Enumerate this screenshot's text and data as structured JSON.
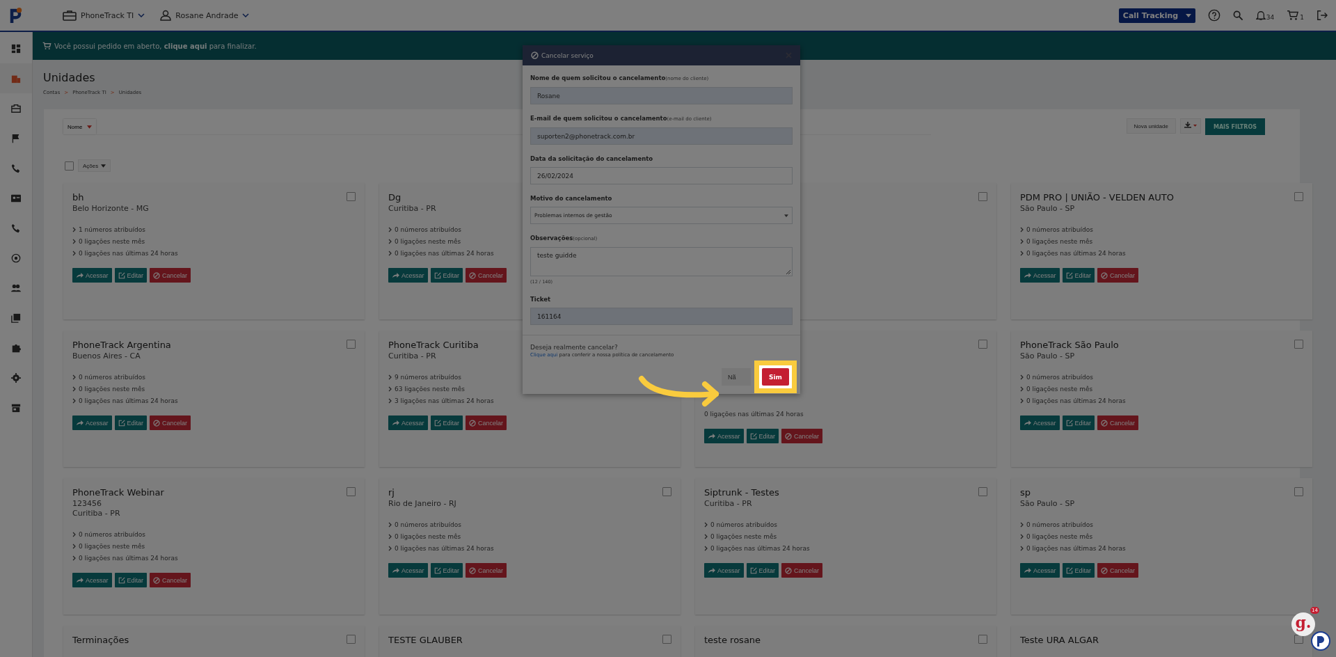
{
  "topbar": {
    "company": "PhoneTrack TI",
    "user": "Rosane Andrade",
    "product": "Call Tracking",
    "notifications": "34",
    "cart": "1"
  },
  "sidebar": {
    "items": [
      {
        "selected": false
      },
      {
        "selected": true
      },
      {
        "selected": false
      },
      {
        "selected": false
      },
      {
        "selected": false
      },
      {
        "selected": false
      },
      {
        "selected": false
      },
      {
        "selected": false
      },
      {
        "selected": false
      },
      {
        "selected": false
      },
      {
        "selected": false
      },
      {
        "selected": false
      },
      {
        "selected": false
      }
    ]
  },
  "banner": {
    "before": "Você possui pedido em aberto, ",
    "link": "clique aqui",
    "after": " para finalizar."
  },
  "page": {
    "title": "Unidades",
    "breadcrumb": [
      {
        "kind": "link",
        "text": "Contas"
      },
      {
        "kind": "separator",
        "text": ">"
      },
      {
        "kind": "link",
        "text": "PhoneTrack TI"
      },
      {
        "kind": "separator",
        "text": ">"
      },
      {
        "kind": "link",
        "text": "Unidades"
      }
    ]
  },
  "filters": {
    "sort": "Nome",
    "new_button": "Nova unidade",
    "more_button": "MAIS FILTROS"
  },
  "bulk": {
    "checked": false,
    "actions": "Ações"
  },
  "cards": [
    {
      "title": "bh",
      "lines": [
        "Belo Horizonte - MG"
      ],
      "checked": false,
      "stats": [
        "1 números atribuídos",
        "0 ligações neste mês",
        "0 ligações nas últimas 24 horas"
      ],
      "buttons": [
        {
          "kind": "access",
          "label": "Acessar"
        },
        {
          "kind": "edit",
          "label": "Editar"
        },
        {
          "kind": "cancel",
          "label": "Cancelar"
        }
      ]
    },
    {
      "title": "Dg",
      "lines": [
        "Curitiba - PR"
      ],
      "stats": [
        "0 números atribuídos",
        "0 ligações neste mês",
        "0 ligações nas últimas 24 horas"
      ],
      "buttons": [
        {
          "kind": "access",
          "label": "Acessar"
        },
        {
          "kind": "edit",
          "label": "Editar"
        },
        {
          "kind": "cancel",
          "label": "Cancelar"
        }
      ]
    },
    {
      "checked": false
    },
    {
      "title": "PDM PRO | UNIÃO - VELDEN AUTO",
      "lines": [
        "São Paulo - SP"
      ],
      "checked": false,
      "stats": [
        "0 números atribuídos",
        "0 ligações neste mês",
        "0 ligações nas últimas 24 horas"
      ],
      "buttons": [
        {
          "kind": "access",
          "label": "Acessar"
        },
        {
          "kind": "edit",
          "label": "Editar"
        },
        {
          "kind": "cancel",
          "label": "Cancelar"
        }
      ]
    },
    {
      "title": "PhoneTrack Argentina",
      "lines": [
        "Buenos Aires - CA"
      ],
      "checked": false,
      "stats": [
        "0 números atribuídos",
        "0 ligações neste mês",
        "0 ligações nas últimas 24 horas"
      ],
      "buttons": [
        {
          "kind": "access",
          "label": "Acessar"
        },
        {
          "kind": "edit",
          "label": "Editar"
        },
        {
          "kind": "cancel",
          "label": "Cancelar"
        }
      ]
    },
    {
      "title": "PhoneTrack Curitiba",
      "lines": [
        "Curitiba - PR"
      ],
      "stats": [
        "9 números atribuídos",
        "63 ligações neste mês",
        "3 ligações nas últimas 24 horas"
      ],
      "buttons": [
        {
          "kind": "access",
          "label": "Acessar"
        },
        {
          "kind": "edit",
          "label": "Editar"
        },
        {
          "kind": "cancel",
          "label": "Cancelar"
        }
      ]
    },
    {
      "checked": false,
      "stats_below": [
        "0 ligações nas últimas 24 horas"
      ],
      "buttons": [
        {
          "kind": "access",
          "label": "Acessar"
        },
        {
          "kind": "edit",
          "label": "Editar"
        },
        {
          "kind": "cancel",
          "label": "Cancelar"
        }
      ]
    },
    {
      "title": "PhoneTrack São Paulo",
      "lines": [
        "São Paulo - SP"
      ],
      "checked": false,
      "stats": [
        "0 números atribuídos",
        "0 ligações neste mês",
        "0 ligações nas últimas 24 horas"
      ],
      "buttons": [
        {
          "kind": "access",
          "label": "Acessar"
        },
        {
          "kind": "edit",
          "label": "Editar"
        },
        {
          "kind": "cancel",
          "label": "Cancelar"
        }
      ]
    },
    {
      "title": "PhoneTrack Webinar",
      "lines": [
        "123456",
        "Curitiba - PR"
      ],
      "checked": false,
      "stats": [
        "0 números atribuídos",
        "0 ligações neste mês",
        "0 ligações nas últimas 24 horas"
      ],
      "buttons": [
        {
          "kind": "access",
          "label": "Acessar"
        },
        {
          "kind": "edit",
          "label": "Editar"
        },
        {
          "kind": "cancel",
          "label": "Cancelar"
        }
      ]
    },
    {
      "title": "rj",
      "lines": [
        "Rio de Janeiro - RJ"
      ],
      "checked": false,
      "stats": [
        "0 números atribuídos",
        "0 ligações neste mês",
        "0 ligações nas últimas 24 horas"
      ],
      "buttons": [
        {
          "kind": "access",
          "label": "Acessar"
        },
        {
          "kind": "edit",
          "label": "Editar"
        },
        {
          "kind": "cancel",
          "label": "Cancelar"
        }
      ]
    },
    {
      "title": "Siptrunk - Testes",
      "lines": [
        "Curitiba - PR"
      ],
      "checked": false,
      "stats": [
        "0 números atribuídos",
        "0 ligações neste mês",
        "0 ligações nas últimas 24 horas"
      ],
      "buttons": [
        {
          "kind": "access",
          "label": "Acessar"
        },
        {
          "kind": "edit",
          "label": "Editar"
        },
        {
          "kind": "cancel",
          "label": "Cancelar"
        }
      ]
    },
    {
      "title": "sp",
      "lines": [
        "São Paulo - SP"
      ],
      "checked": false,
      "stats": [
        "0 números atribuídos",
        "0 ligações neste mês",
        "0 ligações nas últimas 24 horas"
      ],
      "buttons": [
        {
          "kind": "access",
          "label": "Acessar"
        },
        {
          "kind": "edit",
          "label": "Editar"
        },
        {
          "kind": "cancel",
          "label": "Cancelar"
        }
      ]
    },
    {
      "title": "Terminações",
      "checked": false
    },
    {
      "title": "TESTE GLAUBER",
      "checked": false
    },
    {
      "title": "teste rosane",
      "checked": false
    },
    {
      "title": "Teste URA ALGAR",
      "checked": false
    }
  ],
  "modal": {
    "title": "Cancelar serviço",
    "fields": [
      {
        "kind": "readonly",
        "label": "Nome de quem solicitou o cancelamento",
        "hint": "(nome do cliente)",
        "value": "Rosane"
      },
      {
        "kind": "readonly",
        "label": "E-mail de quem solicitou o cancelamento",
        "hint": "(e-mail do cliente)",
        "value": "suporten2@phonetrack.com.br"
      },
      {
        "kind": "text",
        "label": "Data da solicitação do cancelamento",
        "value": "26/02/2024"
      },
      {
        "kind": "select",
        "label": "Motivo do cancelamento",
        "value": "Problemas internos de gestão"
      },
      {
        "kind": "textarea",
        "label": "Observações",
        "hint": "(opcional)",
        "value": "teste guidde",
        "counter": "(12 / 140)"
      },
      {
        "kind": "readonly",
        "label": "Ticket",
        "value": "161164"
      }
    ],
    "question": "Deseja realmente cancelar?",
    "policy_link": "Clique aqui",
    "policy_text": "para conferir a nossa política de cancelamento",
    "no_button": "Nã",
    "yes_button": "Sim"
  },
  "widget": {
    "logo": "g.",
    "badge": "14"
  }
}
